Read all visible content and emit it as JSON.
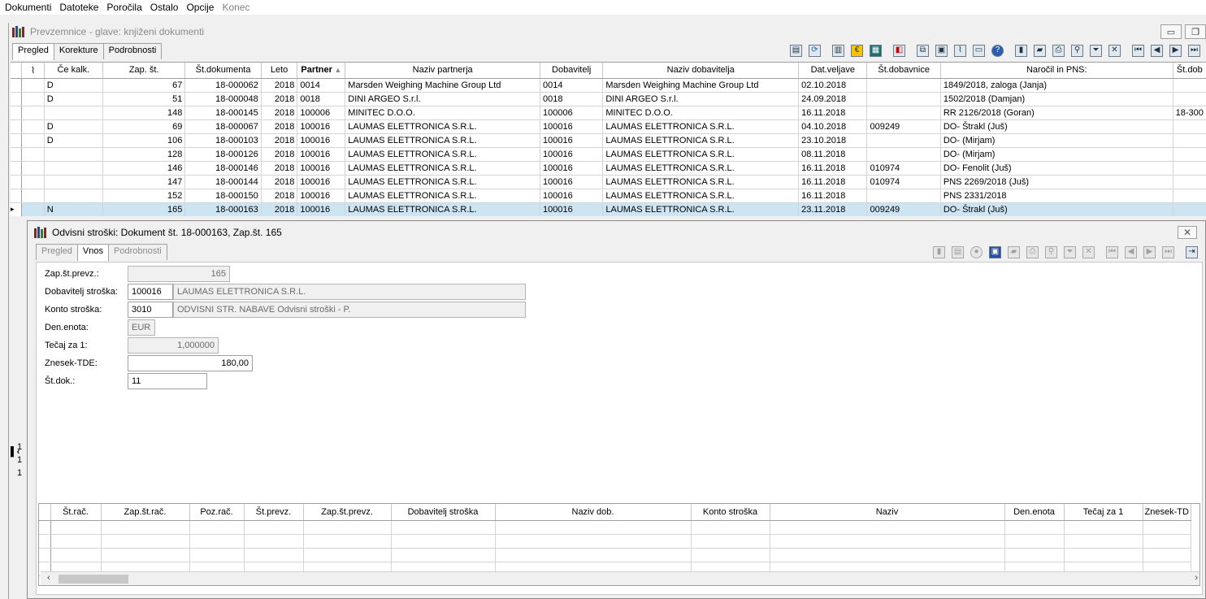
{
  "menu": [
    "Dokumenti",
    "Datoteke",
    "Poročila",
    "Ostalo",
    "Opcije",
    "Konec"
  ],
  "main": {
    "title": "Prevzemnice - glave: knjiženi dokumenti",
    "tabs": [
      "Pregled",
      "Korekture",
      "Podrobnosti"
    ],
    "columns": [
      "Če kalk.",
      "Zap. št.",
      "Št.dokumenta",
      "Leto",
      "Partner",
      "Naziv partnerja",
      "Dobavitelj",
      "Naziv dobavitelja",
      "Dat.veljave",
      "Št.dobavnice",
      "Naročil in PNS:",
      "Št.dob"
    ],
    "rows": [
      {
        "ck": "D",
        "zap": "67",
        "dok": "18-000062",
        "leto": "2018",
        "partner": "0014",
        "naziv": "Marsden Weighing Machine Group Ltd",
        "dob": "0014",
        "nazivdob": "Marsden Weighing Machine Group Ltd",
        "dat": "02.10.2018",
        "stdob": "",
        "nar": "1849/2018, zaloga (Janja)",
        "last": ""
      },
      {
        "ck": "D",
        "zap": "51",
        "dok": "18-000048",
        "leto": "2018",
        "partner": "0018",
        "naziv": "DINI ARGEO S.r.l.",
        "dob": "0018",
        "nazivdob": "DINI ARGEO S.r.l.",
        "dat": "24.09.2018",
        "stdob": "",
        "nar": "1502/2018 (Damjan)",
        "last": ""
      },
      {
        "ck": "",
        "zap": "148",
        "dok": "18-000145",
        "leto": "2018",
        "partner": "100006",
        "naziv": "MINITEC D.O.O.",
        "dob": "100006",
        "nazivdob": "MINITEC D.O.O.",
        "dat": "16.11.2018",
        "stdob": "",
        "nar": "RR 2126/2018 (Goran)",
        "last": "18-300"
      },
      {
        "ck": "D",
        "zap": "69",
        "dok": "18-000067",
        "leto": "2018",
        "partner": "100016",
        "naziv": "LAUMAS ELETTRONICA S.R.L.",
        "dob": "100016",
        "nazivdob": "LAUMAS ELETTRONICA S.R.L.",
        "dat": "04.10.2018",
        "stdob": "009249",
        "nar": "DO- Štrakl (Juš)",
        "last": ""
      },
      {
        "ck": "D",
        "zap": "106",
        "dok": "18-000103",
        "leto": "2018",
        "partner": "100016",
        "naziv": "LAUMAS ELETTRONICA S.R.L.",
        "dob": "100016",
        "nazivdob": "LAUMAS ELETTRONICA S.R.L.",
        "dat": "23.10.2018",
        "stdob": "",
        "nar": "DO- (Mirjam)",
        "last": ""
      },
      {
        "ck": "",
        "zap": "128",
        "dok": "18-000126",
        "leto": "2018",
        "partner": "100016",
        "naziv": "LAUMAS ELETTRONICA S.R.L.",
        "dob": "100016",
        "nazivdob": "LAUMAS ELETTRONICA S.R.L.",
        "dat": "08.11.2018",
        "stdob": "",
        "nar": "DO- (Mirjam)",
        "last": ""
      },
      {
        "ck": "",
        "zap": "146",
        "dok": "18-000146",
        "leto": "2018",
        "partner": "100016",
        "naziv": "LAUMAS ELETTRONICA S.R.L.",
        "dob": "100016",
        "nazivdob": "LAUMAS ELETTRONICA S.R.L.",
        "dat": "16.11.2018",
        "stdob": "010974",
        "nar": "DO- Fenolit (Juš)",
        "last": ""
      },
      {
        "ck": "",
        "zap": "147",
        "dok": "18-000144",
        "leto": "2018",
        "partner": "100016",
        "naziv": "LAUMAS ELETTRONICA S.R.L.",
        "dob": "100016",
        "nazivdob": "LAUMAS ELETTRONICA S.R.L.",
        "dat": "16.11.2018",
        "stdob": "010974",
        "nar": "PNS 2269/2018 (Juš)",
        "last": ""
      },
      {
        "ck": "",
        "zap": "152",
        "dok": "18-000150",
        "leto": "2018",
        "partner": "100016",
        "naziv": "LAUMAS ELETTRONICA S.R.L.",
        "dob": "100016",
        "nazivdob": "LAUMAS ELETTRONICA S.R.L.",
        "dat": "16.11.2018",
        "stdob": "",
        "nar": "PNS 2331/2018",
        "last": ""
      },
      {
        "ck": "N",
        "zap": "165",
        "dok": "18-000163",
        "leto": "2018",
        "partner": "100016",
        "naziv": "LAUMAS ELETTRONICA S.R.L.",
        "dob": "100016",
        "nazivdob": "LAUMAS ELETTRONICA S.R.L.",
        "dat": "23.11.2018",
        "stdob": "009249",
        "nar": "DO- Štrakl (Juš)",
        "last": ""
      }
    ]
  },
  "child": {
    "title": "Odvisni stroški: Dokument št. 18-000163, Zap.št. 165",
    "tabs": [
      "Pregled",
      "Vnos",
      "Podrobnosti"
    ],
    "fields": {
      "zap_label": "Zap.št.prevz.:",
      "zap_value": "165",
      "dob_label": "Dobavitelj stroška:",
      "dob_code": "100016",
      "dob_name": "LAUMAS ELETTRONICA S.R.L.",
      "konto_label": "Konto stroška:",
      "konto_code": "3010",
      "konto_name": "ODVISNI STR. NABAVE Odvisni stroški - P.",
      "den_label": "Den.enota:",
      "den_value": "EUR",
      "tecaj_label": "Tečaj za 1:",
      "tecaj_value": "1,000000",
      "znesek_label": "Znesek-TDE:",
      "znesek_value": "180,00",
      "stdok_label": "Št.dok.:",
      "stdok_value": "11"
    },
    "columns": [
      "Št.rač.",
      "Zap.št.rač.",
      "Poz.rač.",
      "Št.prevz.",
      "Zap.št.prevz.",
      "Dobavitelj stroška",
      "Naziv dob.",
      "Konto stroška",
      "Naziv",
      "Den.enota",
      "Tečaj za 1",
      "Znesek-TD"
    ]
  },
  "stubs": [
    "1",
    "1",
    "1"
  ]
}
